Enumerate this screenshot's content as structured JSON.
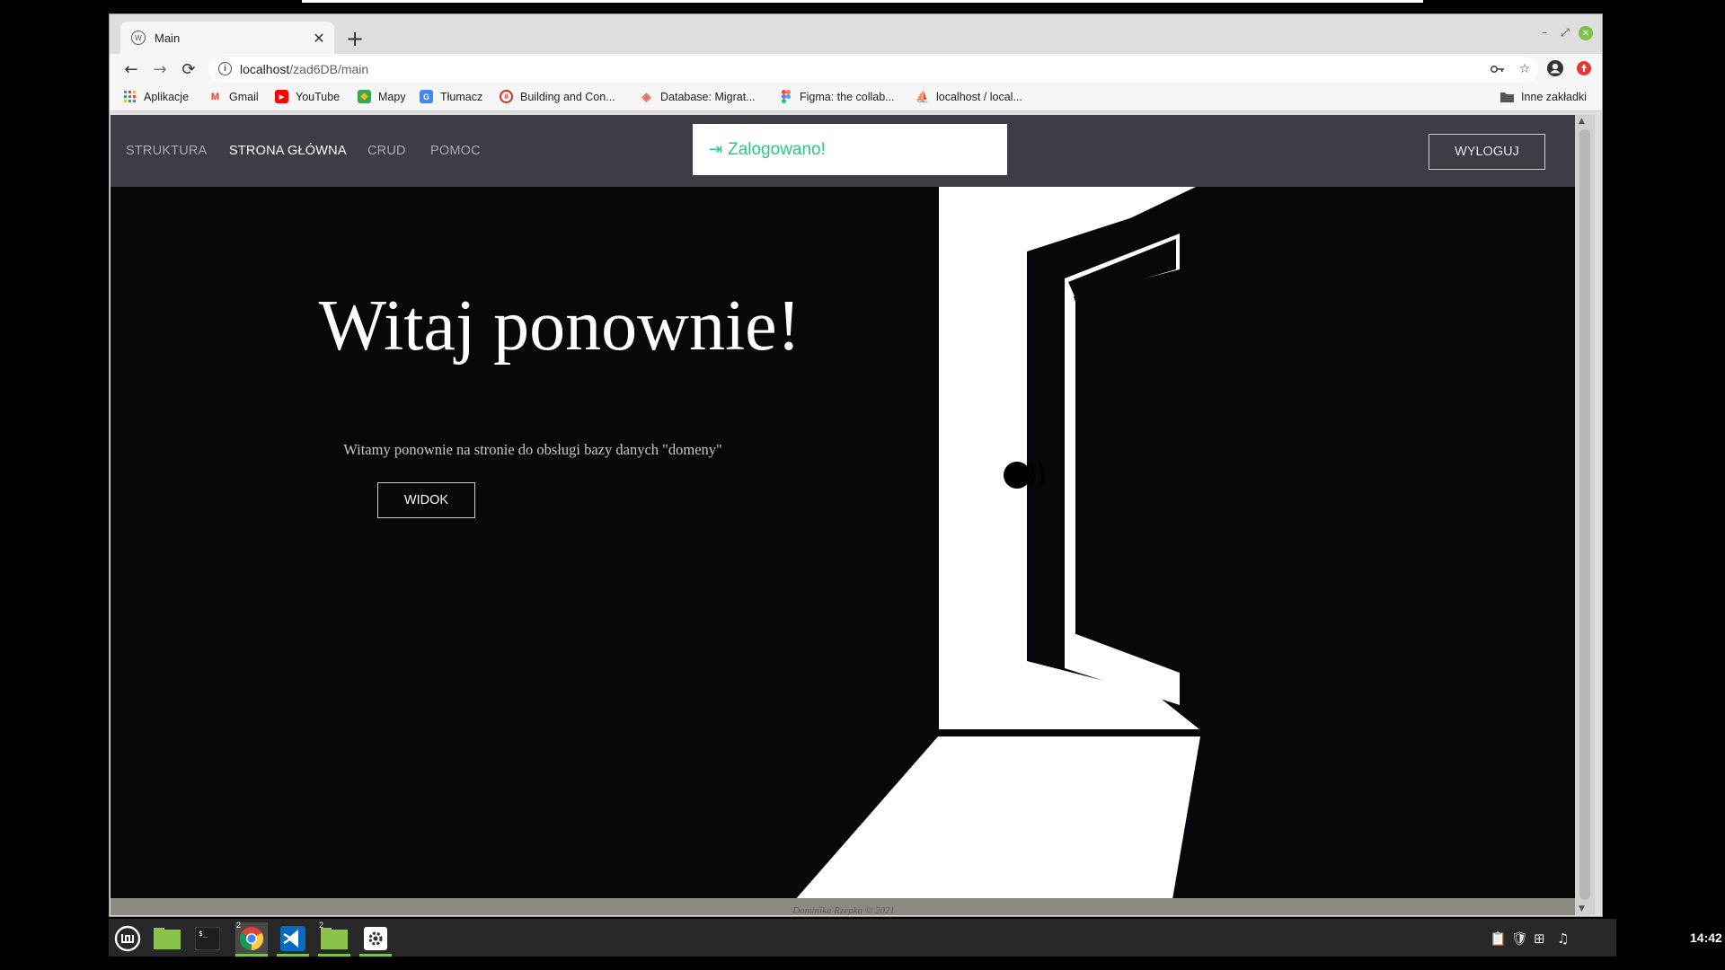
{
  "browser": {
    "tab_title": "Main",
    "tab_favicon_text": "W",
    "tab_close": "✕",
    "new_tab": "+",
    "window_controls": [
      "–",
      "⤢",
      "✕"
    ],
    "nav": {
      "back": "←",
      "forward": "→",
      "reload": "⟳"
    },
    "url_host": "localhost",
    "url_path": "/zad6DB/main",
    "bookmarks": [
      {
        "label": "Aplikacje",
        "icon": "apps-grid-icon"
      },
      {
        "label": "Gmail",
        "icon": "gmail-icon"
      },
      {
        "label": "YouTube",
        "icon": "youtube-icon"
      },
      {
        "label": "Mapy",
        "icon": "maps-icon"
      },
      {
        "label": "Tłumacz",
        "icon": "translate-icon"
      },
      {
        "label": "Building and Con...",
        "icon": "bootstrap-like-icon"
      },
      {
        "label": "Database: Migrat...",
        "icon": "laravel-icon"
      },
      {
        "label": "Figma: the collab...",
        "icon": "figma-icon"
      },
      {
        "label": "localhost / local...",
        "icon": "phpmyadmin-icon"
      }
    ],
    "other_bookmarks": "Inne zakładki"
  },
  "page": {
    "nav_links": [
      {
        "label": "STRUKTURA",
        "active": false
      },
      {
        "label": "STRONA GŁÓWNA",
        "active": true
      },
      {
        "label": "CRUD",
        "active": false
      },
      {
        "label": "POMOC",
        "active": false
      }
    ],
    "toast": "Zalogowano!",
    "logout_label": "WYLOGUJ",
    "hero_title": "Witaj ponownie!",
    "hero_subtitle": "Witamy ponownie na stronie do obsługi bazy danych \"domeny\"",
    "hero_button": "WIDOK",
    "footer": "Dominika Rzepka © 2021"
  },
  "taskbar": {
    "clock": "14:42",
    "apps": [
      "mint-menu-icon",
      "files-icon",
      "terminal-icon",
      "chrome-icon",
      "vscode-icon",
      "folder-icon",
      "settings-icon"
    ],
    "badges": {
      "chrome": "2",
      "folder": "2"
    }
  },
  "colors": {
    "navbar_bg": "#3d3d46",
    "hero_bg": "#08080a",
    "toast_text": "#2ec489",
    "footer_bg": "#8c8a7e",
    "taskbar_bg": "#282828",
    "taskbar_active": "#7cc248"
  }
}
